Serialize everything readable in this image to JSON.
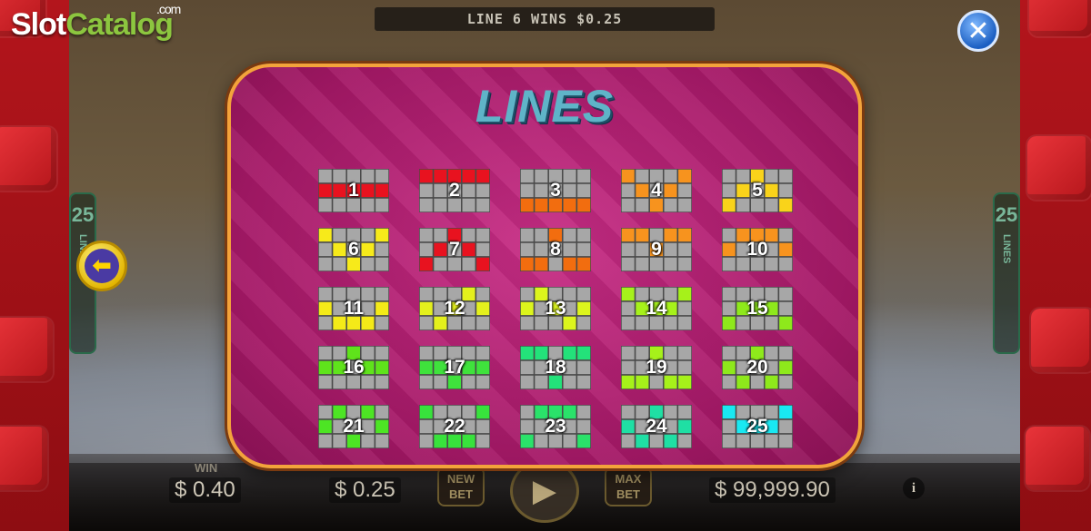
{
  "branding": {
    "logo_slot": "Slot",
    "logo_catalog": "Catalog",
    "logo_com": ".com"
  },
  "top_banner": {
    "text": "LINE 6 WINS $0.25"
  },
  "side_panels": {
    "lines_count": "25",
    "lines_word": "LINES"
  },
  "bottom_bar": {
    "win_label": "WIN",
    "win_value": "$ 0.40",
    "bet_value": "$ 0.25",
    "new_bet_line1": "NEW",
    "new_bet_line2": "BET",
    "max_bet_line1": "MAX",
    "max_bet_line2": "BET",
    "credits_value": "$ 99,999.90",
    "info_label": "i"
  },
  "paytable": {
    "title": "LINES",
    "grid_rows": 3,
    "grid_cols": 5,
    "colors": {
      "cell_empty": "#a7a7a7",
      "cell_border": "#4a4a4a"
    },
    "lines": [
      {
        "number": "1",
        "color": "#e8121f",
        "pattern": [
          1,
          1,
          1,
          1,
          1
        ]
      },
      {
        "number": "2",
        "color": "#e8121f",
        "pattern": [
          0,
          0,
          0,
          0,
          0
        ]
      },
      {
        "number": "3",
        "color": "#f26d0f",
        "pattern": [
          2,
          2,
          2,
          2,
          2
        ]
      },
      {
        "number": "4",
        "color": "#f7931e",
        "pattern": [
          0,
          1,
          2,
          1,
          0
        ]
      },
      {
        "number": "5",
        "color": "#f9d31a",
        "pattern": [
          2,
          1,
          0,
          1,
          2
        ]
      },
      {
        "number": "6",
        "color": "#f7ea1a",
        "pattern": [
          0,
          1,
          2,
          1,
          0
        ]
      },
      {
        "number": "7",
        "color": "#e8121f",
        "pattern": [
          2,
          1,
          0,
          1,
          2
        ]
      },
      {
        "number": "8",
        "color": "#f26d0f",
        "pattern": [
          2,
          2,
          0,
          2,
          2
        ]
      },
      {
        "number": "9",
        "color": "#f7931e",
        "pattern": [
          0,
          0,
          1,
          0,
          0
        ]
      },
      {
        "number": "10",
        "color": "#f7931e",
        "pattern": [
          1,
          0,
          0,
          0,
          1
        ]
      },
      {
        "number": "11",
        "color": "#f4ea18",
        "pattern": [
          1,
          2,
          2,
          2,
          1
        ]
      },
      {
        "number": "12",
        "color": "#e4f01c",
        "pattern": [
          1,
          2,
          1,
          0,
          1
        ]
      },
      {
        "number": "13",
        "color": "#dcf51c",
        "pattern": [
          1,
          0,
          1,
          2,
          1
        ]
      },
      {
        "number": "14",
        "color": "#a6f11a",
        "pattern": [
          0,
          1,
          1,
          1,
          0
        ]
      },
      {
        "number": "15",
        "color": "#8ee91b",
        "pattern": [
          2,
          1,
          1,
          1,
          2
        ]
      },
      {
        "number": "16",
        "color": "#5fe31b",
        "pattern": [
          1,
          1,
          0,
          1,
          1
        ]
      },
      {
        "number": "17",
        "color": "#3fe23c",
        "pattern": [
          1,
          1,
          2,
          1,
          1
        ]
      },
      {
        "number": "18",
        "color": "#23e27a",
        "pattern": [
          0,
          0,
          2,
          0,
          0
        ]
      },
      {
        "number": "19",
        "color": "#a6f11a",
        "pattern": [
          2,
          2,
          0,
          2,
          2
        ]
      },
      {
        "number": "20",
        "color": "#8ee91b",
        "pattern": [
          1,
          2,
          0,
          2,
          1
        ]
      },
      {
        "number": "21",
        "color": "#4de524",
        "pattern": [
          1,
          0,
          2,
          0,
          1
        ]
      },
      {
        "number": "22",
        "color": "#38e23c",
        "pattern": [
          0,
          2,
          2,
          2,
          0
        ]
      },
      {
        "number": "23",
        "color": "#2ae26a",
        "pattern": [
          2,
          0,
          0,
          0,
          2
        ]
      },
      {
        "number": "24",
        "color": "#1fdfa4",
        "pattern": [
          1,
          2,
          0,
          2,
          1
        ]
      },
      {
        "number": "25",
        "color": "#19e9f2",
        "pattern": [
          0,
          1,
          1,
          1,
          0
        ]
      }
    ]
  }
}
